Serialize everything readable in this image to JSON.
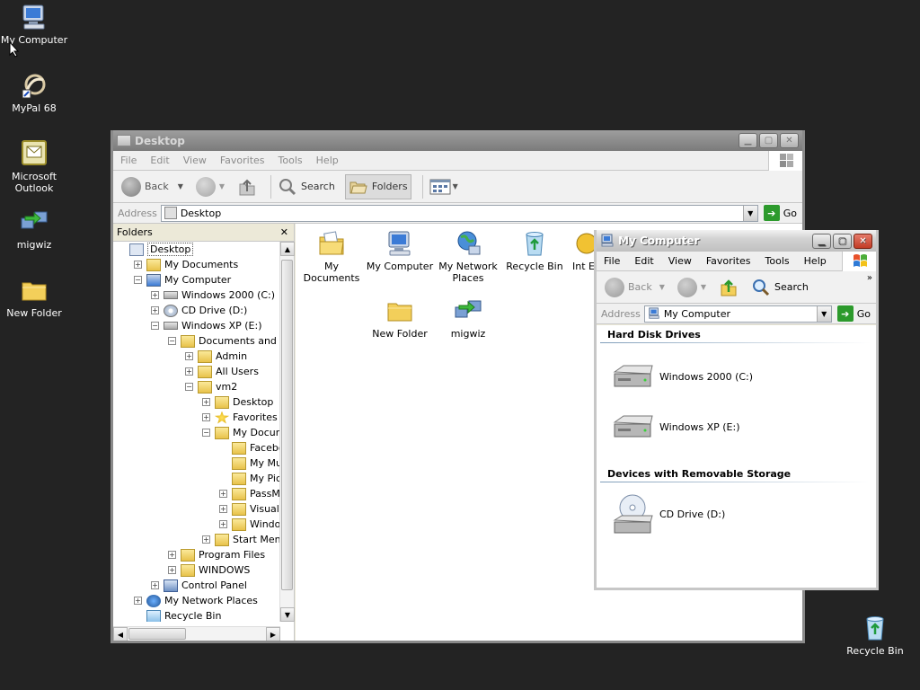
{
  "desktop": {
    "icons": [
      {
        "label": "My Computer",
        "icon": "my-computer-icon"
      },
      {
        "label": "MyPal 68",
        "icon": "mypal-icon"
      },
      {
        "label": "Microsoft Outlook",
        "icon": "outlook-icon"
      },
      {
        "label": "migwiz",
        "icon": "migwiz-icon"
      },
      {
        "label": "New Folder",
        "icon": "folder-icon"
      },
      {
        "label": "Recycle Bin",
        "icon": "recycle-bin-icon"
      }
    ]
  },
  "explorer": {
    "title": "Desktop",
    "menu": [
      "File",
      "Edit",
      "View",
      "Favorites",
      "Tools",
      "Help"
    ],
    "toolbar": {
      "back": "Back",
      "search": "Search",
      "folders": "Folders"
    },
    "address_label": "Address",
    "address_value": "Desktop",
    "go": "Go",
    "folders_header": "Folders",
    "close_glyph": "✕",
    "tree": [
      {
        "label": "Desktop",
        "indent": 0,
        "pm": "",
        "icon": "desktop"
      },
      {
        "label": "My Documents",
        "indent": 1,
        "pm": "+",
        "icon": "docs"
      },
      {
        "label": "My Computer",
        "indent": 1,
        "pm": "−",
        "icon": "computer"
      },
      {
        "label": "Windows 2000 (C:)",
        "indent": 2,
        "pm": "+",
        "icon": "drive"
      },
      {
        "label": "CD Drive (D:)",
        "indent": 2,
        "pm": "+",
        "icon": "cd"
      },
      {
        "label": "Windows XP (E:)",
        "indent": 2,
        "pm": "−",
        "icon": "drive"
      },
      {
        "label": "Documents and Settin",
        "indent": 3,
        "pm": "−",
        "icon": "folder"
      },
      {
        "label": "Admin",
        "indent": 4,
        "pm": "+",
        "icon": "folder"
      },
      {
        "label": "All Users",
        "indent": 4,
        "pm": "+",
        "icon": "folder"
      },
      {
        "label": "vm2",
        "indent": 4,
        "pm": "−",
        "icon": "folder"
      },
      {
        "label": "Desktop",
        "indent": 5,
        "pm": "+",
        "icon": "folder"
      },
      {
        "label": "Favorites",
        "indent": 5,
        "pm": "+",
        "icon": "star"
      },
      {
        "label": "My Document",
        "indent": 5,
        "pm": "−",
        "icon": "folder"
      },
      {
        "label": "Facebook",
        "indent": 6,
        "pm": "",
        "icon": "folder"
      },
      {
        "label": "My Music",
        "indent": 6,
        "pm": "",
        "icon": "music"
      },
      {
        "label": "My Picture",
        "indent": 6,
        "pm": "",
        "icon": "pictures"
      },
      {
        "label": "PassMark",
        "indent": 6,
        "pm": "+",
        "icon": "folder"
      },
      {
        "label": "Visual Stu",
        "indent": 6,
        "pm": "+",
        "icon": "folder"
      },
      {
        "label": "Windows",
        "indent": 6,
        "pm": "+",
        "icon": "folder"
      },
      {
        "label": "Start Menu",
        "indent": 5,
        "pm": "+",
        "icon": "folder"
      },
      {
        "label": "Program Files",
        "indent": 3,
        "pm": "+",
        "icon": "folder"
      },
      {
        "label": "WINDOWS",
        "indent": 3,
        "pm": "+",
        "icon": "folder"
      },
      {
        "label": "Control Panel",
        "indent": 2,
        "pm": "+",
        "icon": "control"
      },
      {
        "label": "My Network Places",
        "indent": 1,
        "pm": "+",
        "icon": "network"
      },
      {
        "label": "Recycle Bin",
        "indent": 1,
        "pm": "",
        "icon": "recycle"
      }
    ],
    "content_icons": [
      {
        "label": "My Documents",
        "icon": "my-documents-icon"
      },
      {
        "label": "My Computer",
        "icon": "my-computer-icon"
      },
      {
        "label": "My Network Places",
        "icon": "network-places-icon"
      },
      {
        "label": "Recycle Bin",
        "icon": "recycle-bin-icon"
      },
      {
        "label": "Int Ex",
        "icon": "internet-explorer-icon"
      },
      {
        "label": "New Folder",
        "icon": "folder-icon"
      },
      {
        "label": "migwiz",
        "icon": "migwiz-icon"
      }
    ]
  },
  "mycomputer": {
    "title": "My Computer",
    "menu": [
      "File",
      "Edit",
      "View",
      "Favorites",
      "Tools",
      "Help"
    ],
    "toolbar": {
      "back": "Back",
      "search": "Search"
    },
    "address_label": "Address",
    "address_value": "My Computer",
    "go": "Go",
    "sections": [
      {
        "title": "Hard Disk Drives",
        "items": [
          "Windows 2000 (C:)",
          "Windows XP (E:)"
        ]
      },
      {
        "title": "Devices with Removable Storage",
        "items": [
          "CD Drive (D:)"
        ]
      }
    ]
  },
  "colors": {
    "desktop": "#232323",
    "go_green": "#2c9a2c",
    "folder": "#e8c24a"
  }
}
